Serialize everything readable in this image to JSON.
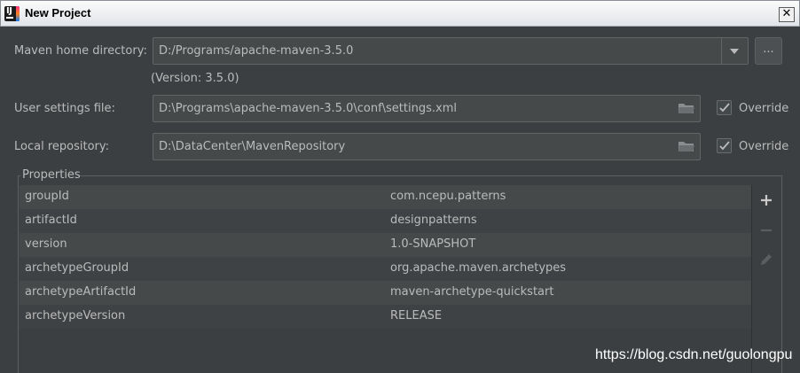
{
  "window": {
    "title": "New Project"
  },
  "maven_home": {
    "label": "Maven home directory:",
    "value": "D:/Programs/apache-maven-3.5.0",
    "browse_label": "...",
    "version_note": "(Version: 3.5.0)"
  },
  "user_settings": {
    "label": "User settings file:",
    "value": "D:\\Programs\\apache-maven-3.5.0\\conf\\settings.xml",
    "override_label": "Override",
    "override_checked": true
  },
  "local_repo": {
    "label": "Local repository:",
    "value": "D:\\DataCenter\\MavenRepository",
    "override_label": "Override",
    "override_checked": true
  },
  "properties": {
    "title": "Properties",
    "rows": [
      {
        "key": "groupId",
        "value": "com.ncepu.patterns"
      },
      {
        "key": "artifactId",
        "value": "designpatterns"
      },
      {
        "key": "version",
        "value": "1.0-SNAPSHOT"
      },
      {
        "key": "archetypeGroupId",
        "value": "org.apache.maven.archetypes"
      },
      {
        "key": "archetypeArtifactId",
        "value": "maven-archetype-quickstart"
      },
      {
        "key": "archetypeVersion",
        "value": "RELEASE"
      }
    ],
    "tools": [
      "add-icon",
      "remove-icon",
      "edit-icon"
    ]
  },
  "watermark": "https://blog.csdn.net/guolongpu",
  "colors": {
    "background": "#3c3f41",
    "field": "#45494a",
    "row_even": "#45494a",
    "row_odd": "#3f4244",
    "text": "#bbbbbb"
  }
}
